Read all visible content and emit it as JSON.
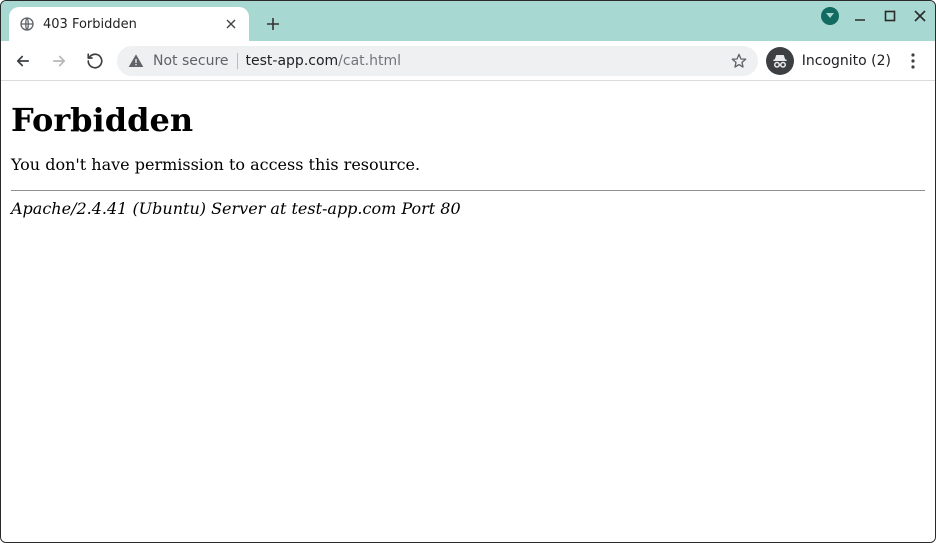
{
  "tab": {
    "title": "403 Forbidden"
  },
  "omnibox": {
    "not_secure_label": "Not secure",
    "url_host": "test-app.com",
    "url_path": "/cat.html"
  },
  "incognito": {
    "label": "Incognito (2)"
  },
  "page": {
    "heading": "Forbidden",
    "message": "You don't have permission to access this resource.",
    "server_line": "Apache/2.4.41 (Ubuntu) Server at test-app.com Port 80"
  }
}
